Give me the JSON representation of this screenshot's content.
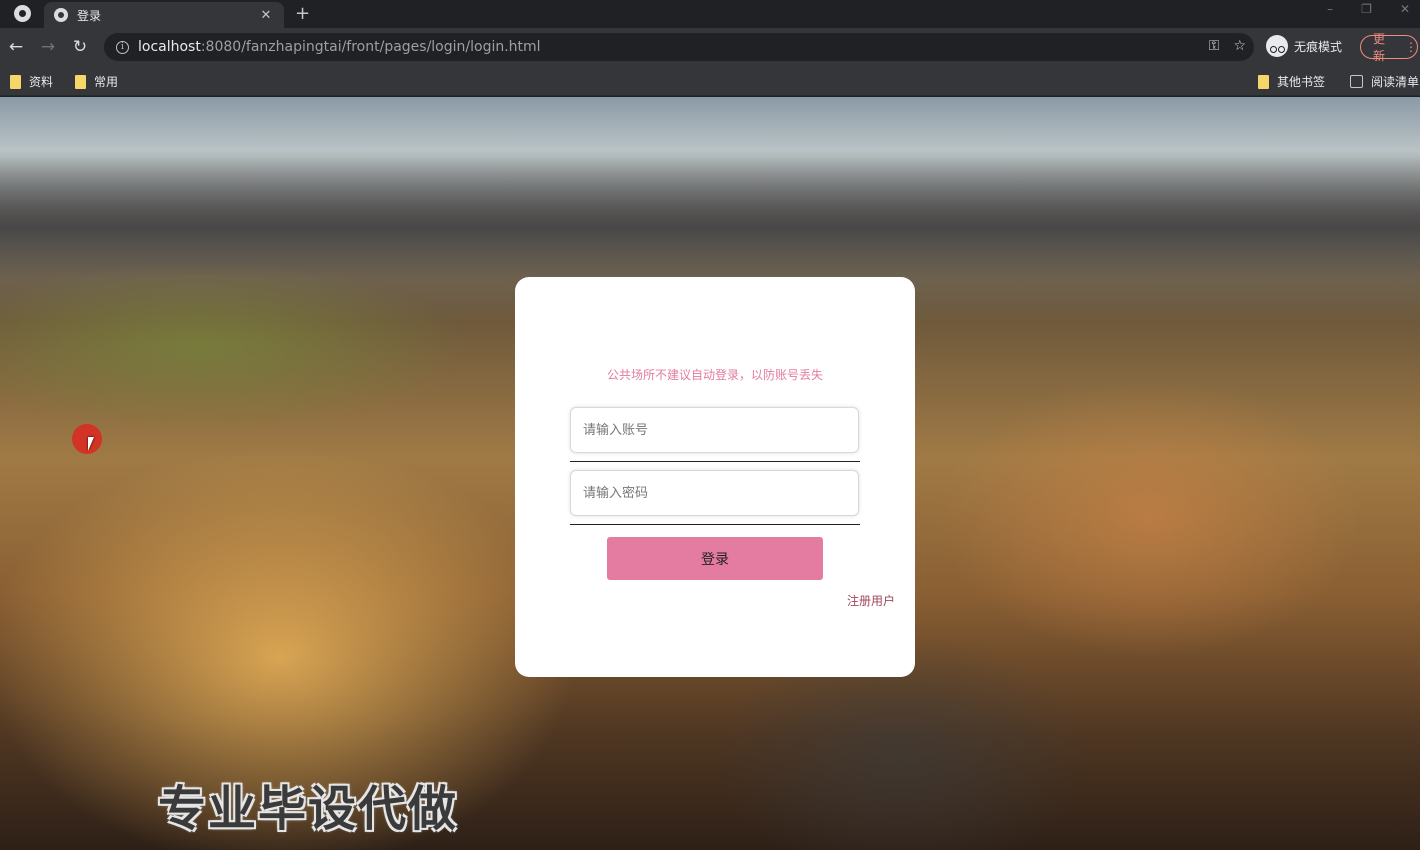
{
  "browser": {
    "tab_title": "登录",
    "url_host": "localhost",
    "url_path": ":8080/fanzhapingtai/front/pages/login/login.html",
    "incognito_label": "无痕模式",
    "update_label": "更新",
    "bookmarks": {
      "left": [
        "资料",
        "常用"
      ],
      "other": "其他书签",
      "reading_list": "阅读清单"
    }
  },
  "login": {
    "notice": "公共场所不建议自动登录，以防账号丢失",
    "account_placeholder": "请输入账号",
    "password_placeholder": "请输入密码",
    "login_button": "登录",
    "register_link": "注册用户"
  },
  "overlay": {
    "watermark": "专业毕设代做"
  },
  "colors": {
    "accent": "#e37ca0",
    "link": "#a0465a"
  }
}
